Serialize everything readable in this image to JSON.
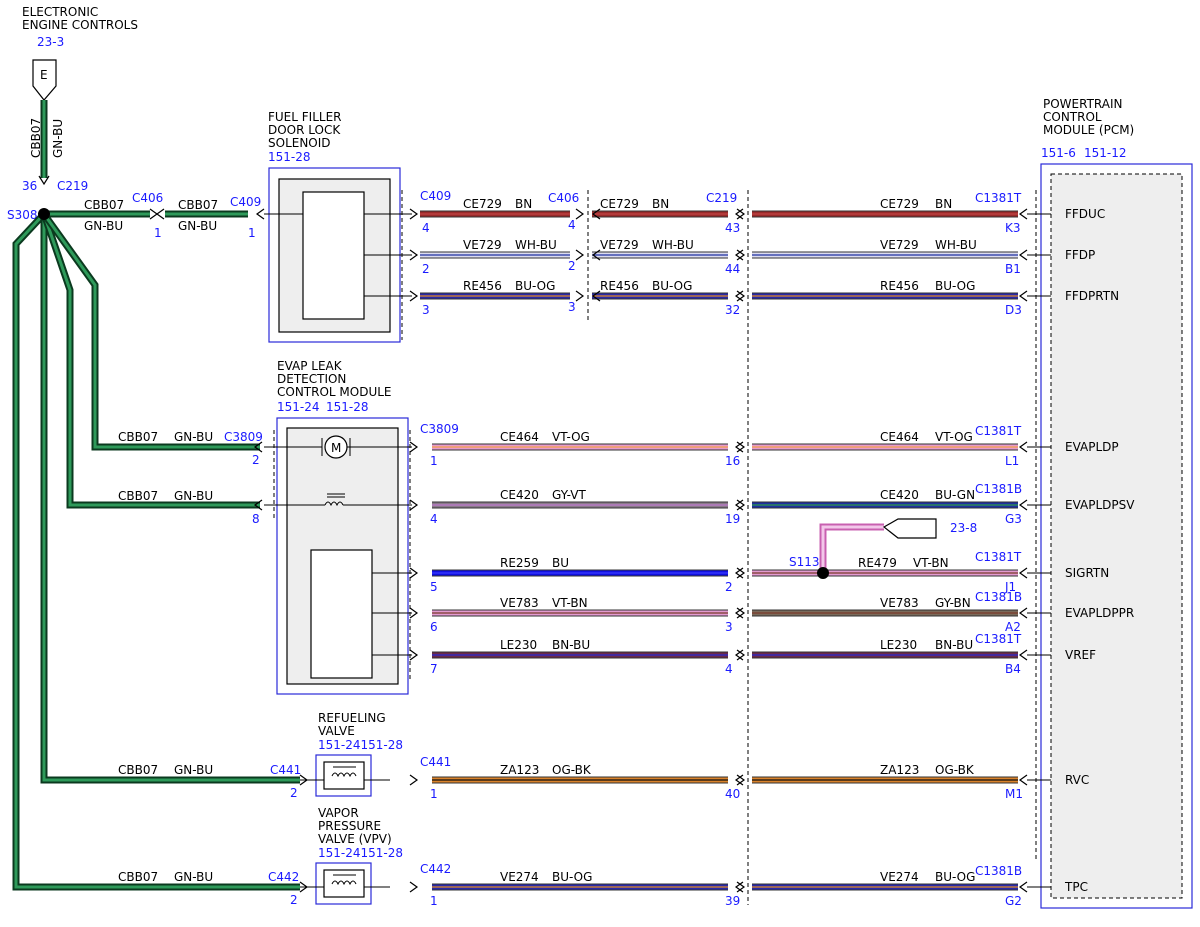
{
  "colors": {
    "BN": "#9a2b2b",
    "WH-BU": "#dcdcf0",
    "BU-OG": "#2a2aa8",
    "GN-BU": "#1f6b3f",
    "VT-OG": "#e69acb",
    "GY-VT": "#8a7a8a",
    "BU-GN": "#1e2fa0",
    "BU": "#1010e0",
    "VT-BN": "#e29ad0",
    "GY-BN": "#7a6a5a",
    "BN-BU": "#6a2a4a",
    "OG-BK": "#d9822b",
    "VT-BN-split": "#c860b0"
  },
  "components": {
    "eec": {
      "line1": "ELECTRONIC",
      "line2": "ENGINE CONTROLS",
      "ref": "23-3",
      "symbol": "E"
    },
    "ffdls": {
      "line1": "FUEL FILLER",
      "line2": "DOOR LOCK",
      "line3": "SOLENOID",
      "ref": "151-28"
    },
    "evap": {
      "line1": "EVAP LEAK",
      "line2": "DETECTION",
      "line3": "CONTROL MODULE",
      "ref1": "151-24",
      "ref2": "151-28"
    },
    "refuel": {
      "line1": "REFUELING",
      "line2": "VALVE",
      "ref": "151-24151-28"
    },
    "vpv": {
      "line1": "VAPOR",
      "line2": "PRESSURE",
      "line3": "VALVE (VPV)",
      "ref": "151-24151-28"
    },
    "pcm": {
      "line1": "POWERTRAIN",
      "line2": "CONTROL",
      "line3": "MODULE (PCM)",
      "ref1": "151-6",
      "ref2": "151-12"
    }
  },
  "ground_feed": {
    "circuit": "CBB07",
    "color": "GN-BU",
    "pin": "36",
    "connector": "C219",
    "splice": "S308",
    "c406": "C406",
    "c406_pin": "1",
    "c409": "C409",
    "c409_pin": "1"
  },
  "branches": [
    {
      "circuit": "CBB07",
      "color": "GN-BU",
      "connector": "C3809",
      "pin": "2"
    },
    {
      "circuit": "CBB07",
      "color": "GN-BU",
      "connector": "",
      "pin": "8"
    },
    {
      "circuit": "CBB07",
      "color": "GN-BU",
      "connector": "C441",
      "pin": "2"
    },
    {
      "circuit": "CBB07",
      "color": "GN-BU",
      "connector": "C442",
      "pin": "2"
    }
  ],
  "wires": [
    {
      "id": "ffduc",
      "pcm_label": "FFDUC",
      "left_conn": "C409",
      "left_pin": "4",
      "seg1_circuit": "CE729",
      "seg1_color": "BN",
      "mid_conn": "C406",
      "mid_pin": "4",
      "seg2_circuit": "CE729",
      "seg2_color": "BN",
      "mid2_conn": "C219",
      "mid2_pin": "43",
      "seg3_circuit": "CE729",
      "seg3_color": "BN",
      "right_conn": "C1381T",
      "right_pin": "K3"
    },
    {
      "id": "ffdp",
      "pcm_label": "FFDP",
      "left_conn": "",
      "left_pin": "2",
      "seg1_circuit": "VE729",
      "seg1_color": "WH-BU",
      "mid_conn": "",
      "mid_pin": "2",
      "seg2_circuit": "VE729",
      "seg2_color": "WH-BU",
      "mid2_conn": "",
      "mid2_pin": "44",
      "seg3_circuit": "VE729",
      "seg3_color": "WH-BU",
      "right_conn": "",
      "right_pin": "B1"
    },
    {
      "id": "ffdprtn",
      "pcm_label": "FFDPRTN",
      "left_conn": "",
      "left_pin": "3",
      "seg1_circuit": "RE456",
      "seg1_color": "BU-OG",
      "mid_conn": "",
      "mid_pin": "3",
      "seg2_circuit": "RE456",
      "seg2_color": "BU-OG",
      "mid2_conn": "",
      "mid2_pin": "32",
      "seg3_circuit": "RE456",
      "seg3_color": "BU-OG",
      "right_conn": "",
      "right_pin": "D3"
    },
    {
      "id": "evapldp",
      "pcm_label": "EVAPLDP",
      "left_conn": "C3809",
      "left_pin": "1",
      "seg1_circuit": "CE464",
      "seg1_color": "VT-OG",
      "mid2_pin": "16",
      "seg3_circuit": "CE464",
      "seg3_color": "VT-OG",
      "right_conn": "C1381T",
      "right_pin": "L1"
    },
    {
      "id": "evapldpsv",
      "pcm_label": "EVAPLDPSV",
      "left_conn": "",
      "left_pin": "4",
      "seg1_circuit": "CE420",
      "seg1_color": "GY-VT",
      "mid2_pin": "19",
      "seg3_circuit": "CE420",
      "seg3_color": "BU-GN",
      "right_conn": "C1381B",
      "right_pin": "G3"
    },
    {
      "id": "sigrtn",
      "pcm_label": "SIGRTN",
      "left_conn": "",
      "left_pin": "5",
      "seg1_circuit": "RE259",
      "seg1_color": "BU",
      "mid2_pin": "2",
      "seg3_circuit": "RE479",
      "seg3_color": "VT-BN",
      "right_conn": "C1381T",
      "right_pin": "J1",
      "splice": "S113",
      "splice_ref": "23-8"
    },
    {
      "id": "evapldppr",
      "pcm_label": "EVAPLDPPR",
      "left_conn": "",
      "left_pin": "6",
      "seg1_circuit": "VE783",
      "seg1_color": "VT-BN",
      "mid2_pin": "3",
      "seg3_circuit": "VE783",
      "seg3_color": "GY-BN",
      "right_conn": "C1381B",
      "right_pin": "A2"
    },
    {
      "id": "vref",
      "pcm_label": "VREF",
      "left_conn": "",
      "left_pin": "7",
      "seg1_circuit": "LE230",
      "seg1_color": "BN-BU",
      "mid2_pin": "4",
      "seg3_circuit": "LE230",
      "seg3_color": "BN-BU",
      "right_conn": "C1381T",
      "right_pin": "B4"
    },
    {
      "id": "rvc",
      "pcm_label": "RVC",
      "left_conn": "C441",
      "left_pin": "1",
      "seg1_circuit": "ZA123",
      "seg1_color": "OG-BK",
      "mid2_pin": "40",
      "seg3_circuit": "ZA123",
      "seg3_color": "OG-BK",
      "right_conn": "",
      "right_pin": "M1"
    },
    {
      "id": "tpc",
      "pcm_label": "TPC",
      "left_conn": "C442",
      "left_pin": "1",
      "seg1_circuit": "VE274",
      "seg1_color": "BU-OG",
      "mid2_pin": "39",
      "seg3_circuit": "VE274",
      "seg3_color": "BU-OG",
      "right_conn": "C1381B",
      "right_pin": "G2"
    }
  ]
}
